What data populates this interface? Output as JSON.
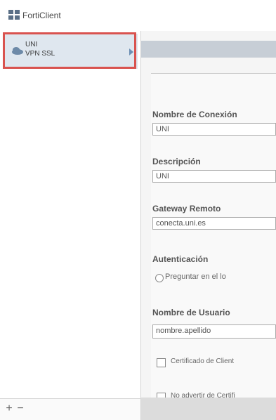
{
  "app": {
    "title": "FortiClient"
  },
  "sidebar": {
    "connection": {
      "name": "UNI",
      "type": "VPN SSL"
    },
    "add_label": "+",
    "remove_label": "−"
  },
  "form": {
    "connection_name": {
      "label": "Nombre de Conexión",
      "value": "UNI"
    },
    "description": {
      "label": "Descripción",
      "value": "UNI"
    },
    "remote_gateway": {
      "label": "Gateway Remoto",
      "value": "conecta.uni.es"
    },
    "authentication": {
      "label": "Autenticación",
      "option": "Preguntar en el lo"
    },
    "username": {
      "label": "Nombre de Usuario",
      "value": "nombre.apellido"
    },
    "client_certificate": {
      "label": "Certificado de Client"
    },
    "dont_warn_certificate": {
      "label": "No advertir de Certifi"
    }
  }
}
